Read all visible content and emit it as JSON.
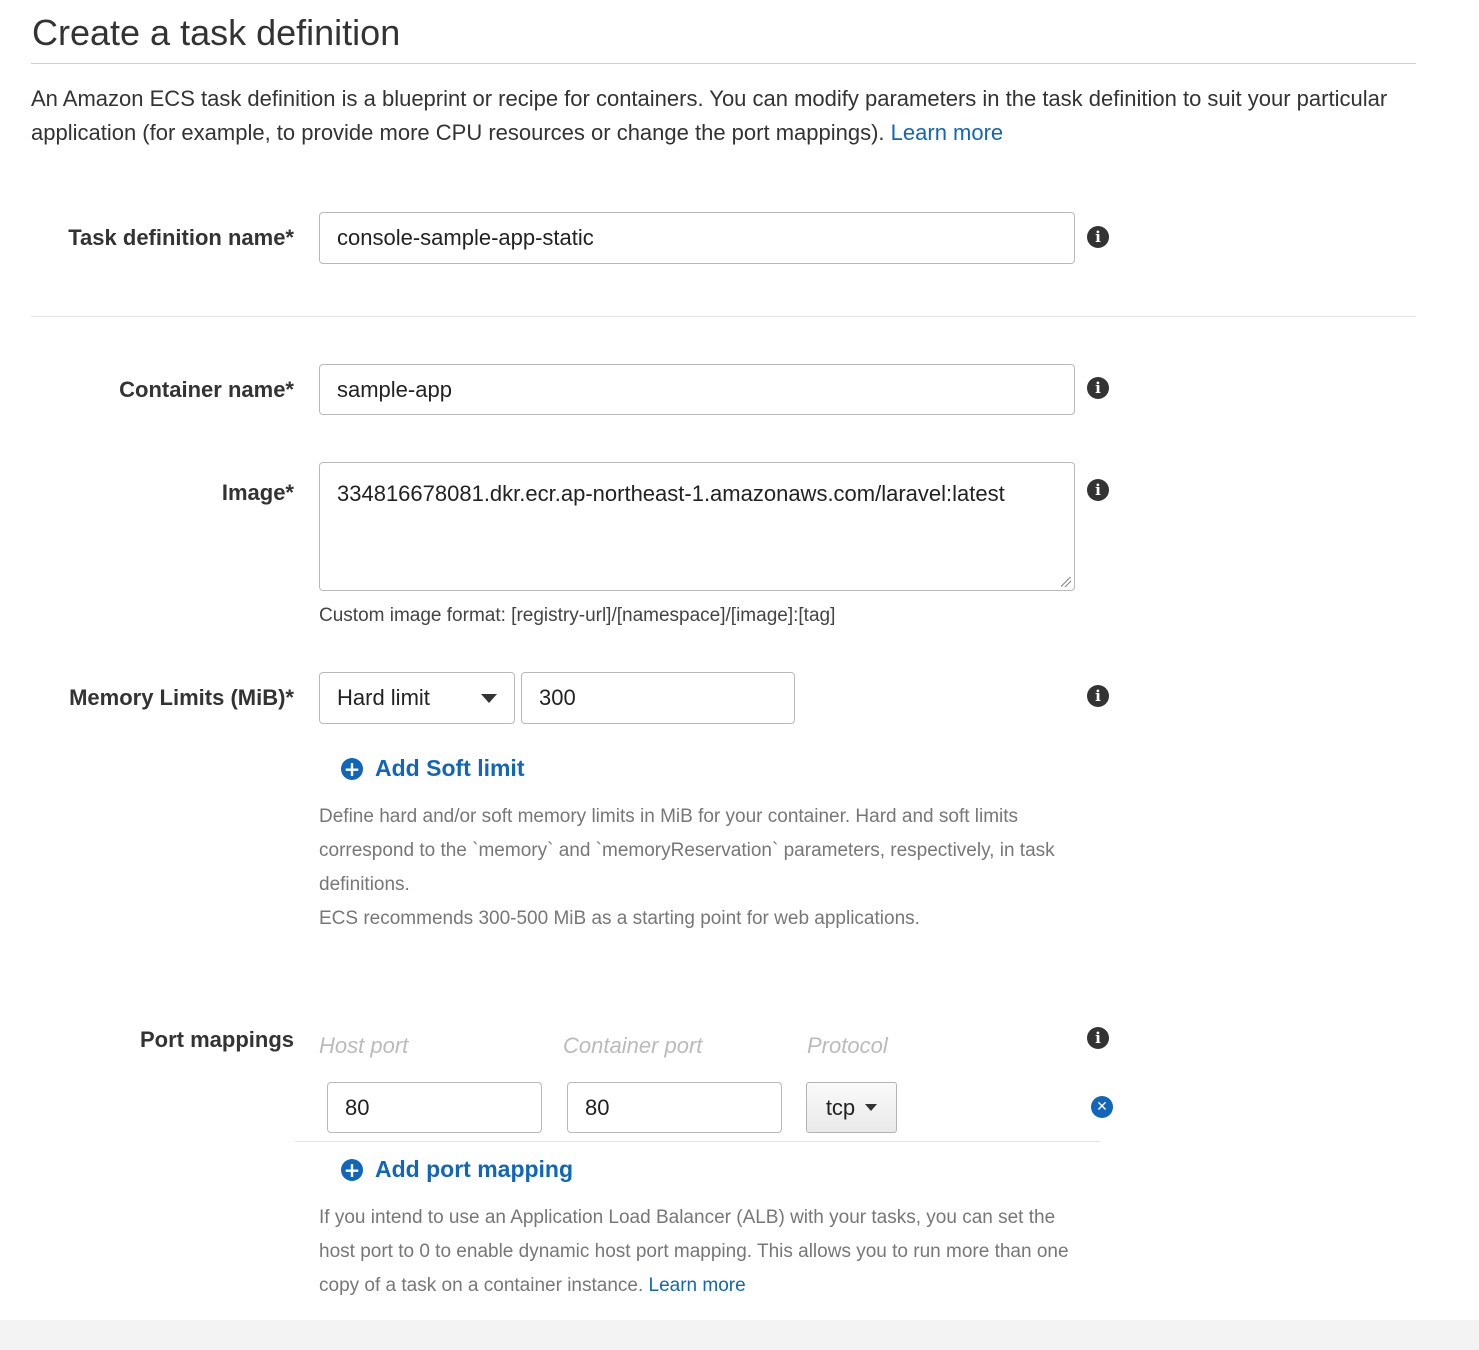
{
  "page": {
    "title": "Create a task definition",
    "description": "An Amazon ECS task definition is a blueprint or recipe for containers. You can modify parameters in the task definition to suit your particular application (for example, to provide more CPU resources or change the port mappings). ",
    "description_link": "Learn more"
  },
  "task_definition_name": {
    "label": "Task definition name*",
    "value": "console-sample-app-static"
  },
  "container_name": {
    "label": "Container name*",
    "value": "sample-app"
  },
  "image": {
    "label": "Image*",
    "value": "334816678081.dkr.ecr.ap-northeast-1.amazonaws.com/laravel:latest",
    "hint": "Custom image format: [registry-url]/[namespace]/[image]:[tag]"
  },
  "memory": {
    "label": "Memory Limits (MiB)*",
    "limit_type": "Hard limit",
    "value": "300",
    "add_soft_limit": "Add Soft limit",
    "help_1": "Define hard and/or soft memory limits in MiB for your container. Hard and soft limits correspond to the `memory` and `memoryReservation` parameters, respectively, in task definitions.",
    "help_2": "ECS recommends 300-500 MiB as a starting point for web applications."
  },
  "ports": {
    "label": "Port mappings",
    "col_host": "Host port",
    "col_container": "Container port",
    "col_protocol": "Protocol",
    "rows": [
      {
        "host": "80",
        "container": "80",
        "protocol": "tcp"
      }
    ],
    "add_mapping": "Add port mapping",
    "help": "If you intend to use an Application Load Balancer (ALB) with your tasks, you can set the host port to 0 to enable dynamic host port mapping. This allows you to run more than one copy of a task on a container instance. ",
    "help_link": "Learn more"
  },
  "icons": {
    "info": "info-icon",
    "add": "plus-circle-icon",
    "remove": "close-circle-icon",
    "dropdown": "caret-down-icon"
  },
  "colors": {
    "link": "#1166bb",
    "text": "#333333",
    "muted": "#777777",
    "border": "#b9b9b9"
  }
}
